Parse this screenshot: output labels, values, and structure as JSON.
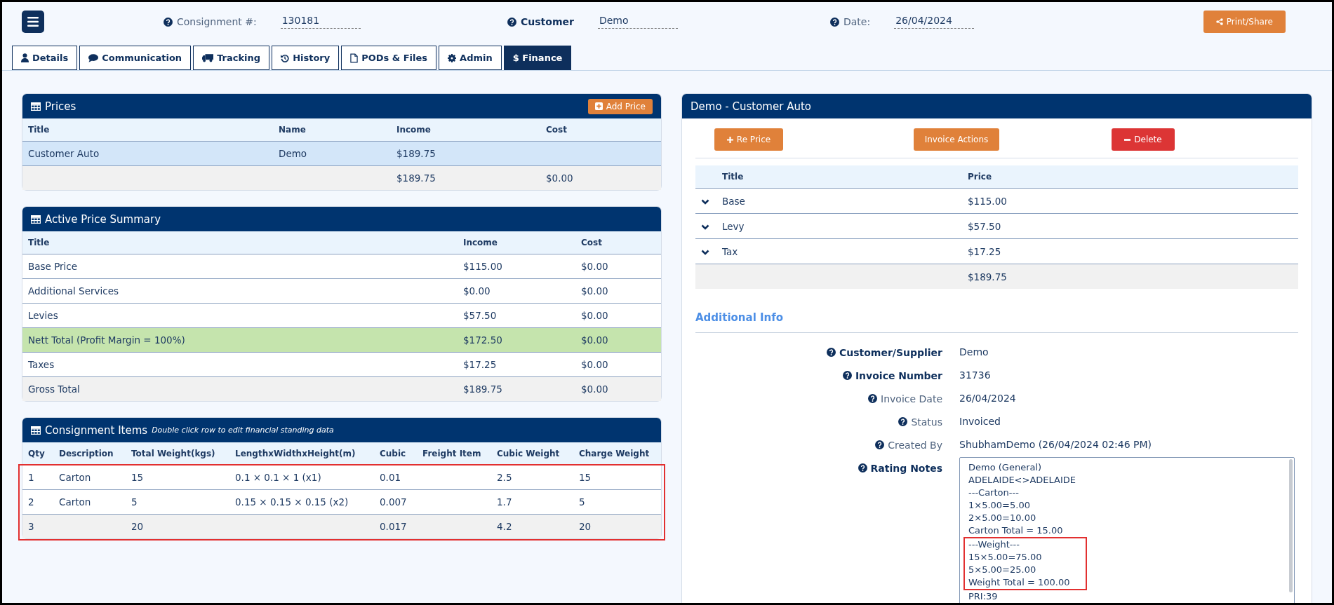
{
  "header": {
    "fields": [
      {
        "label": "Consignment #:",
        "value": "130181",
        "emphasis": false
      },
      {
        "label": "Customer",
        "value": "Demo",
        "emphasis": true
      },
      {
        "label": "Date:",
        "value": "26/04/2024",
        "emphasis": false
      }
    ],
    "print_button": "Print/Share"
  },
  "tabs": [
    {
      "label": "Details",
      "kind": "person",
      "selected": false
    },
    {
      "label": "Communication",
      "kind": "messages",
      "selected": false
    },
    {
      "label": "Tracking",
      "kind": "tracking",
      "selected": false
    },
    {
      "label": "History",
      "kind": "history",
      "selected": false
    },
    {
      "label": "PODs & Files",
      "kind": "files",
      "selected": false
    },
    {
      "label": "Admin",
      "kind": "admin",
      "selected": false
    },
    {
      "label": "$ Finance",
      "kind": "finance",
      "selected": true
    }
  ],
  "prices": {
    "title": "Prices",
    "add_button": "Add Price",
    "columns": [
      "Title",
      "Name",
      "Income",
      "Cost"
    ],
    "rows": [
      {
        "kind": "item",
        "selected": true,
        "cells": [
          "Customer Auto",
          "Demo",
          "$189.75",
          ""
        ]
      },
      {
        "kind": "total",
        "selected": false,
        "cells": [
          "",
          "",
          "$189.75",
          "$0.00"
        ]
      }
    ]
  },
  "summary": {
    "title": "Active Price Summary",
    "columns": [
      "Title",
      "Income",
      "Cost"
    ],
    "rows": [
      {
        "kind": "normal",
        "cells": [
          "Base Price",
          "$115.00",
          "$0.00"
        ]
      },
      {
        "kind": "normal",
        "cells": [
          "Additional Services",
          "$0.00",
          "$0.00"
        ]
      },
      {
        "kind": "normal",
        "cells": [
          "Levies",
          "$57.50",
          "$0.00"
        ]
      },
      {
        "kind": "good",
        "cells": [
          "Nett Total (Profit Margin = 100%)",
          "$172.50",
          "$0.00"
        ]
      },
      {
        "kind": "normal",
        "cells": [
          "Taxes",
          "$17.25",
          "$0.00"
        ]
      },
      {
        "kind": "total",
        "cells": [
          "Gross Total",
          "$189.75",
          "$0.00"
        ]
      }
    ]
  },
  "items": {
    "title": "Consignment Items",
    "hint": "Double click row to edit financial standing data",
    "highlighted": true,
    "columns": [
      "Qty",
      "Description",
      "Total Weight(kgs)",
      "LengthxWidthxHeight(m)",
      "Cubic",
      "Freight Item",
      "Cubic Weight",
      "Charge Weight"
    ],
    "rows": [
      {
        "kind": "normal",
        "cells": [
          "1",
          "Carton",
          "15",
          "0.1 × 0.1 × 1 (x1)",
          "0.01",
          "",
          "2.5",
          "15"
        ]
      },
      {
        "kind": "normal",
        "cells": [
          "2",
          "Carton",
          "5",
          "0.15 × 0.15 × 0.15 (x2)",
          "0.007",
          "",
          "1.7",
          "5"
        ]
      },
      {
        "kind": "total",
        "cells": [
          "3",
          "",
          "20",
          "",
          "0.017",
          "",
          "4.2",
          "20"
        ]
      }
    ]
  },
  "detail": {
    "title": "Demo - Customer Auto",
    "buttons": [
      {
        "label": "Re Price",
        "kind": "reprice"
      },
      {
        "label": "Invoice Actions",
        "kind": "actions"
      },
      {
        "label": "Delete",
        "kind": "delete"
      }
    ],
    "columns": [
      "Title",
      "Price"
    ],
    "rows": [
      {
        "kind": "line",
        "cells": [
          "Base",
          "$115.00"
        ]
      },
      {
        "kind": "line",
        "cells": [
          "Levy",
          "$57.50"
        ]
      },
      {
        "kind": "line",
        "cells": [
          "Tax",
          "$17.25"
        ]
      },
      {
        "kind": "total",
        "cells": [
          "",
          "$189.75"
        ]
      }
    ],
    "info_title": "Additional Info",
    "fields": [
      {
        "label": "Customer/Supplier",
        "value": "Demo",
        "emphasis": true
      },
      {
        "label": "Invoice Number",
        "value": "31736",
        "emphasis": true
      },
      {
        "label": "Invoice Date",
        "value": "26/04/2024",
        "emphasis": false
      },
      {
        "label": "Status",
        "value": "Invoiced",
        "emphasis": false
      },
      {
        "label": "Created By",
        "value": "ShubhamDemo (26/04/2024 02:46 PM)",
        "emphasis": false
      }
    ],
    "notes": {
      "label": "Rating Notes",
      "lines": [
        {
          "text": "Demo (General)",
          "highlighted": false
        },
        {
          "text": "ADELAIDE<>ADELAIDE",
          "highlighted": false
        },
        {
          "text": "---Carton---",
          "highlighted": false
        },
        {
          "text": "1×5.00=5.00",
          "highlighted": false
        },
        {
          "text": "2×5.00=10.00",
          "highlighted": false
        },
        {
          "text": "Carton Total = 15.00",
          "highlighted": false
        },
        {
          "text": "---Weight---",
          "highlighted": true
        },
        {
          "text": "15×5.00=75.00",
          "highlighted": true
        },
        {
          "text": "5×5.00=25.00",
          "highlighted": true
        },
        {
          "text": "Weight Total = 100.00",
          "highlighted": true
        },
        {
          "text": "PRI:39",
          "highlighted": false
        }
      ]
    }
  }
}
